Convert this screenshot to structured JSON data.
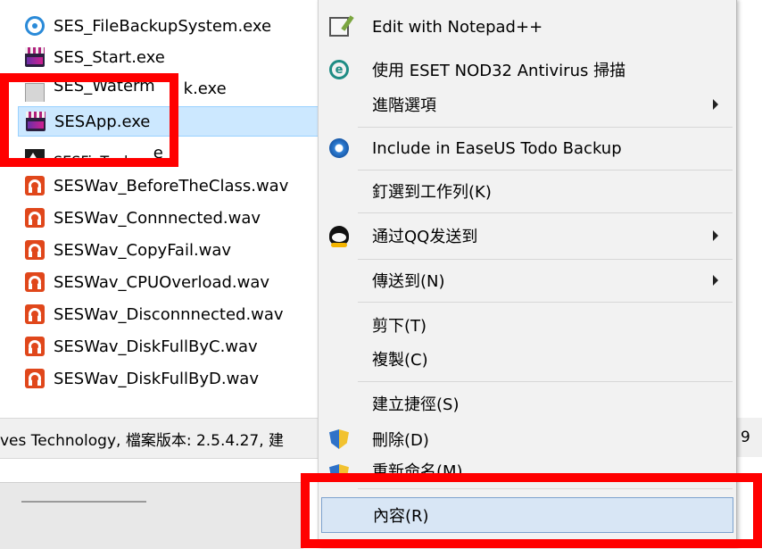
{
  "files": [
    {
      "name": "SES_FileBackupSystem.exe",
      "icon": "sync-icon"
    },
    {
      "name": "SES_Start.exe",
      "icon": "clapperboard-icon"
    },
    {
      "name": "SES_Waterm",
      "icon": "generic-exe-icon",
      "suffix": "k.exe"
    },
    {
      "name": "SESApp.exe",
      "icon": "clapperboard-icon"
    },
    {
      "name": "SESFixTools",
      "icon": "tool-icon",
      "suffix": "e"
    },
    {
      "name": "SESWav_BeforeTheClass.wav",
      "icon": "audio-icon"
    },
    {
      "name": "SESWav_Connnected.wav",
      "icon": "audio-icon"
    },
    {
      "name": "SESWav_CopyFail.wav",
      "icon": "audio-icon"
    },
    {
      "name": "SESWav_CPUOverload.wav",
      "icon": "audio-icon"
    },
    {
      "name": "SESWav_Disconnnected.wav",
      "icon": "audio-icon"
    },
    {
      "name": "SESWav_DiskFullByC.wav",
      "icon": "audio-icon"
    },
    {
      "name": "SESWav_DiskFullByD.wav",
      "icon": "audio-icon"
    }
  ],
  "status": {
    "text": "ves Technology, 檔案版本: 2.5.4.27, 建",
    "right_text": "9"
  },
  "menu": {
    "edit_notepad": "Edit with Notepad++",
    "eset_scan": "使用 ESET NOD32 Antivirus 掃描",
    "advanced": "進階選項",
    "easeus": "Include in EaseUS Todo Backup",
    "pin_taskbar": "釘選到工作列(K)",
    "send_qq": "通过QQ发送到",
    "send_to": "傳送到(N)",
    "cut": "剪下(T)",
    "copy": "複製(C)",
    "shortcut": "建立捷徑(S)",
    "delete": "刪除(D)",
    "rename": "重新命名(M)",
    "properties": "內容(R)"
  },
  "icons": {
    "eset_letter": "e"
  },
  "colors": {
    "annotation": "#ff0000",
    "selection": "#cce8ff",
    "menu_background": "#f2f2f2"
  }
}
